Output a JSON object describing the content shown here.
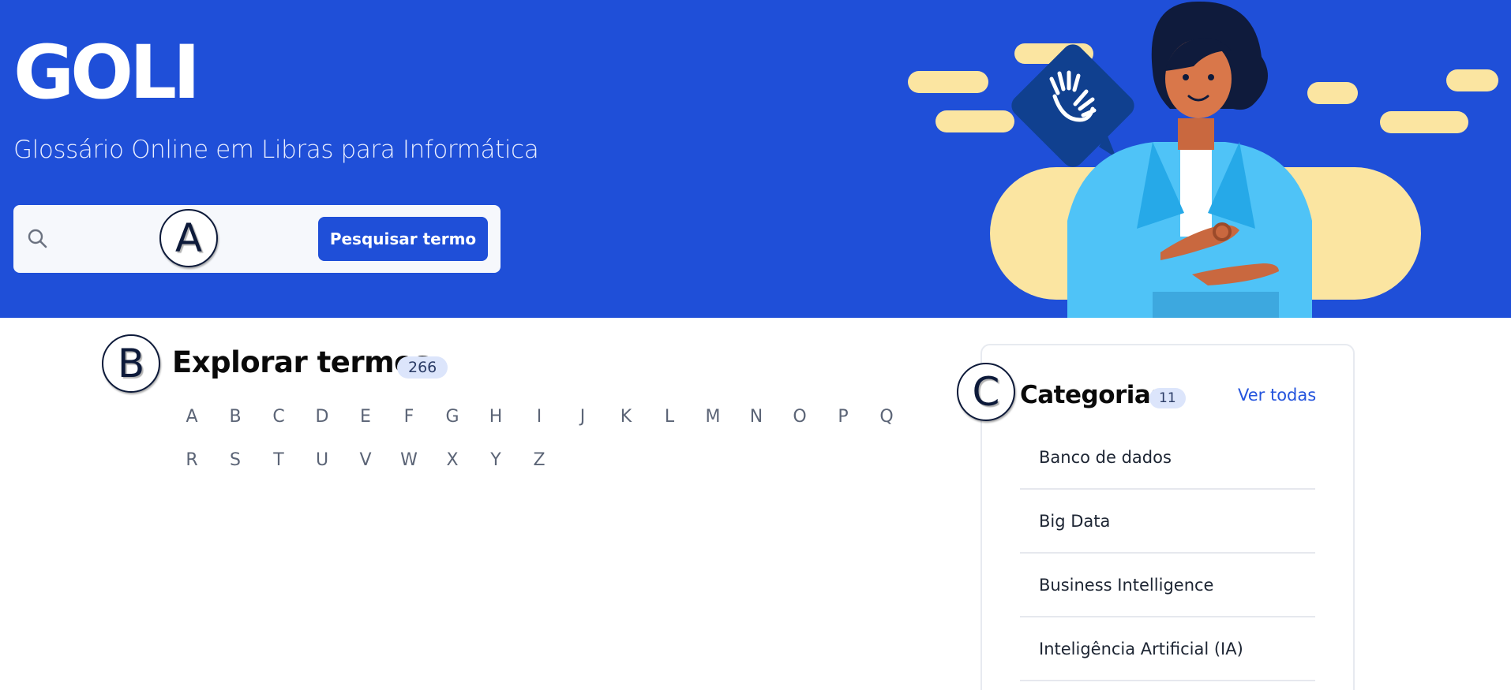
{
  "header": {
    "brand": "GOLI",
    "subtitle": "Glossário Online em Libras para Informática"
  },
  "search": {
    "value": "",
    "placeholder": "",
    "button_label": "Pesquisar termo"
  },
  "callouts": {
    "a": "A",
    "b": "B",
    "c": "C"
  },
  "explore": {
    "title": "Explorar termos",
    "count": "266",
    "letters_row1": [
      "A",
      "B",
      "C",
      "D",
      "E",
      "F",
      "G",
      "H",
      "I",
      "J",
      "K",
      "L",
      "M",
      "N",
      "O",
      "P",
      "Q"
    ],
    "letters_row2": [
      "R",
      "S",
      "T",
      "U",
      "V",
      "W",
      "X",
      "Y",
      "Z"
    ]
  },
  "categories": {
    "title": "Categorias",
    "count": "11",
    "see_all": "Ver todas",
    "items": [
      "Banco de dados",
      "Big Data",
      "Business Intelligence",
      "Inteligência Artificial (IA)"
    ]
  },
  "colors": {
    "brand_blue": "#1f4fd8",
    "badge_bg": "#dce5fb",
    "link": "#2454dd",
    "illustration_yellow": "#fbe5a1"
  },
  "icons": {
    "search": "search-icon",
    "sign_language": "sign-language-icon"
  }
}
